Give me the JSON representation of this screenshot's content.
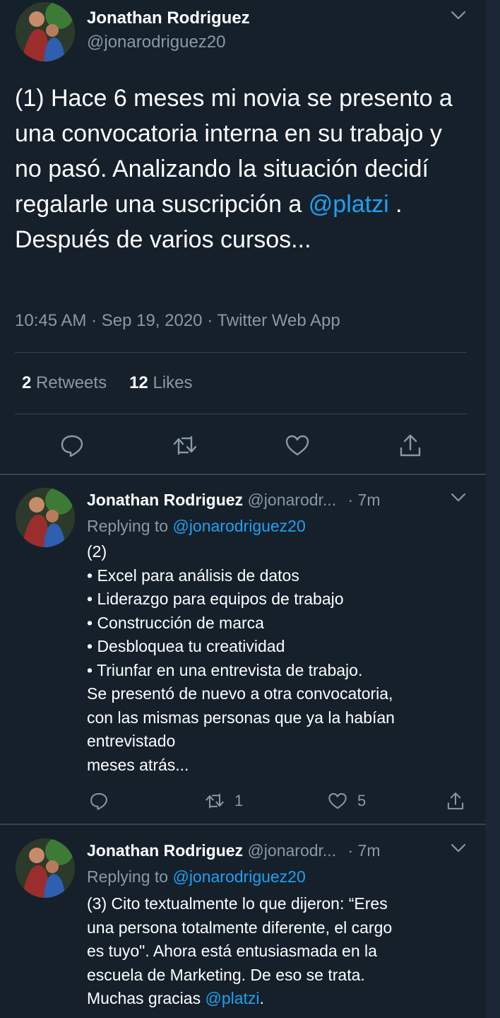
{
  "main_tweet": {
    "author_name": "Jonathan Rodriguez",
    "author_handle": "@jonarodriguez20",
    "text_part1": "(1) Hace 6 meses mi novia se presento a una convocatoria interna en su trabajo y no pasó. Analizando la situación decidí regalarle una suscripción a ",
    "mention": "@platzi",
    "text_part2": " . Después de varios cursos...",
    "timestamp": "10:45 AM · Sep 19, 2020 · Twitter Web App",
    "retweets_count": "2",
    "retweets_label": "Retweets",
    "likes_count": "12",
    "likes_label": "Likes"
  },
  "replies": [
    {
      "author_name": "Jonathan Rodriguez",
      "author_handle": "@jonarodr...",
      "time": "· 7m",
      "replying_prefix": "Replying to",
      "replying_handle": "@jonarodriguez20",
      "lines": [
        "(2)",
        "• Excel para análisis de datos",
        "• Liderazgo para equipos de trabajo",
        "• Construcción de marca",
        "• Desbloquea tu creatividad",
        "• Triunfar en una entrevista de trabajo.",
        "Se presentó de nuevo a otra convocatoria,",
        "con las mismas personas que ya la habían",
        "entrevistado",
        "meses atrás..."
      ],
      "retweets": "1",
      "likes": "5"
    },
    {
      "author_name": "Jonathan Rodriguez",
      "author_handle": "@jonarodr...",
      "time": "· 7m",
      "replying_prefix": "Replying to",
      "replying_handle": "@jonarodriguez20",
      "lines": [
        "(3) Cito textualmente lo que dijeron: “Eres",
        "una persona totalmente diferente, el cargo",
        "es tuyo\". Ahora está entusiasmada en la",
        "escuela de Marketing. De eso se trata."
      ],
      "last_line_prefix": "Muchas gracias ",
      "last_line_mention": "@platzi",
      "last_line_suffix": "."
    }
  ],
  "colors": {
    "background": "#15202b",
    "text_primary": "#ffffff",
    "text_secondary": "#8899a6",
    "accent": "#1da1f2",
    "divider": "#38444d"
  },
  "icons": [
    "chevron-down-icon",
    "reply-icon",
    "retweet-icon",
    "like-icon",
    "share-icon"
  ]
}
